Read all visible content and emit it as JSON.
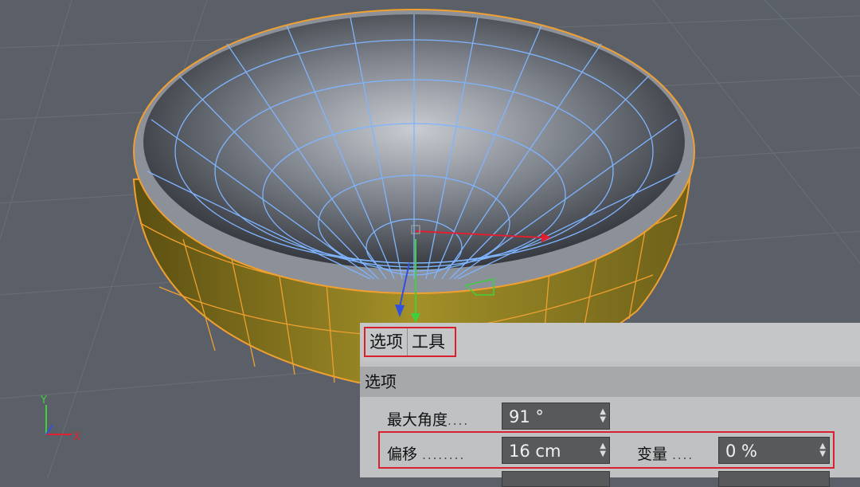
{
  "tabs": [
    {
      "label": "选项"
    },
    {
      "label": "工具"
    }
  ],
  "section": {
    "title": "选项"
  },
  "fields": {
    "max_angle": {
      "label": "最大角度",
      "dots": "....",
      "value": "91 °"
    },
    "offset": {
      "label": "偏移",
      "dots": "........",
      "value": "16 cm"
    },
    "variation": {
      "label": "变量",
      "dots": "....",
      "value": "0 %"
    }
  },
  "axes": {
    "x": "X",
    "y": "Y"
  },
  "colors": {
    "wire": "#7fb4ff",
    "selection": "#f0a030",
    "outer_shell": "#8a7a1f",
    "highlight": "#d8202f"
  }
}
